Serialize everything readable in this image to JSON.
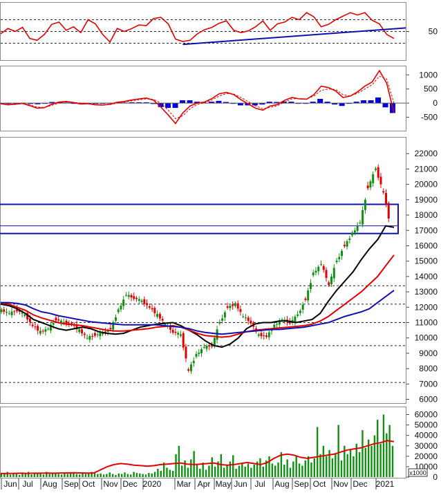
{
  "chart_data": [
    {
      "type": "line",
      "panel": "rsi",
      "ylim": [
        0,
        100
      ],
      "y_ticks": [
        "50"
      ],
      "reference_lines": [
        70,
        50,
        30
      ],
      "series": [
        {
          "values": [
            46,
            55,
            50,
            57,
            38,
            35,
            45,
            62,
            66,
            52,
            58,
            48,
            70,
            63,
            45,
            32,
            55,
            50,
            55,
            61,
            60,
            72,
            74,
            63,
            37,
            33,
            35,
            46,
            53,
            57,
            64,
            68,
            52,
            48,
            51,
            58,
            68,
            52,
            63,
            66,
            74,
            70,
            82,
            75,
            58,
            62,
            70,
            76,
            82,
            78,
            82,
            69,
            63,
            45,
            38
          ]
        }
      ],
      "trendline": {
        "points": [
          [
            25,
            28
          ],
          [
            54,
            55
          ]
        ]
      }
    },
    {
      "type": "line",
      "panel": "macd",
      "ylim": [
        -1000,
        1300
      ],
      "y_ticks": [
        "1000",
        "500",
        "0",
        "-500"
      ],
      "series": [
        {
          "values": [
            -20,
            -60,
            -40,
            -10,
            -90,
            -180,
            -160,
            -40,
            40,
            60,
            20,
            -30,
            -20,
            -60,
            -70,
            -40,
            30,
            60,
            110,
            150,
            180,
            100,
            -140,
            -420,
            -720,
            -350,
            -100,
            0,
            40,
            160,
            330,
            380,
            300,
            120,
            -30,
            -180,
            -250,
            -100,
            -50,
            100,
            200,
            150,
            140,
            300,
            600,
            550,
            430,
            200,
            250,
            400,
            600,
            750,
            1150,
            700,
            -350
          ]
        },
        {
          "values": [
            -10,
            -40,
            -40,
            -20,
            -60,
            -140,
            -150,
            -80,
            0,
            40,
            30,
            0,
            -10,
            -40,
            -60,
            -50,
            0,
            40,
            80,
            120,
            150,
            130,
            0,
            -250,
            -550,
            -450,
            -200,
            -50,
            20,
            110,
            250,
            340,
            320,
            200,
            50,
            -100,
            -200,
            -150,
            -90,
            40,
            150,
            160,
            150,
            250,
            450,
            500,
            480,
            300,
            250,
            350,
            500,
            650,
            950,
            850,
            0
          ]
        }
      ],
      "histogram": [
        -10,
        -20,
        0,
        10,
        -30,
        -40,
        -10,
        40,
        40,
        20,
        -10,
        -30,
        -10,
        -20,
        -10,
        10,
        30,
        20,
        30,
        30,
        30,
        -30,
        -140,
        -170,
        -170,
        100,
        100,
        50,
        20,
        50,
        80,
        40,
        -20,
        -80,
        -80,
        -80,
        -50,
        50,
        40,
        60,
        50,
        -10,
        -10,
        50,
        150,
        50,
        -50,
        -100,
        0,
        50,
        100,
        100,
        200,
        -150,
        -350
      ]
    },
    {
      "type": "line",
      "panel": "price",
      "ylim": [
        5800,
        23000
      ],
      "y_ticks": [
        "22000",
        "21000",
        "20000",
        "19000",
        "18000",
        "17000",
        "16000",
        "15000",
        "14000",
        "13000",
        "12000",
        "11000",
        "10000",
        "9000",
        "8000",
        "7000",
        "6000"
      ],
      "reference_lines": [
        13400,
        12200,
        11000,
        9500,
        7100
      ],
      "zone": [
        16800,
        18700
      ],
      "zone_midline": 17300,
      "series": [
        {
          "values": [
            11800,
            11600,
            11800,
            11500,
            10800,
            10400,
            10600,
            11200,
            11000,
            10900,
            10500,
            10000,
            10200,
            10300,
            10600,
            11800,
            12800,
            12600,
            12400,
            12000,
            11500,
            10900,
            10400,
            10200,
            7900,
            8900,
            9400,
            9500,
            11000,
            12000,
            12200,
            11400,
            11000,
            10200,
            10100,
            10800,
            11200,
            11000,
            11500,
            12500,
            14200,
            14800,
            13500,
            15000,
            16000,
            16800,
            17500,
            19800,
            21000,
            19500,
            17000
          ]
        },
        {
          "values": [
            12200,
            12100,
            11900,
            11600,
            11200,
            11000,
            10800,
            10600,
            10500,
            10600,
            10700,
            10600,
            10400,
            10300,
            10250,
            10300,
            10500,
            10700,
            10800,
            10900,
            10950,
            11000,
            10800,
            10500,
            10200,
            9800,
            9500,
            9400,
            9600,
            10000,
            10600,
            10900,
            11000,
            11000,
            11100,
            11100,
            11000,
            11100,
            11200,
            11600,
            12400,
            13100,
            13700,
            14300,
            15100,
            15800,
            16400,
            17300,
            17200
          ]
        },
        {
          "values": [
            12300,
            12200,
            12000,
            11800,
            11500,
            11300,
            11150,
            11000,
            10900,
            10850,
            10800,
            10700,
            10600,
            10500,
            10450,
            10450,
            10500,
            10550,
            10600,
            10700,
            10750,
            10800,
            10700,
            10500,
            10300,
            10150,
            10100,
            10050,
            10100,
            10250,
            10400,
            10500,
            10550,
            10600,
            10650,
            10700,
            10750,
            10800,
            10900,
            11100,
            11400,
            11800,
            12200,
            12600,
            13000,
            13500,
            14000,
            14700,
            15400
          ]
        },
        {
          "values": [
            12300,
            12300,
            12250,
            12150,
            11900,
            11700,
            11600,
            11450,
            11350,
            11250,
            11150,
            11050,
            11000,
            10950,
            10900,
            10850,
            10850,
            10850,
            10850,
            10850,
            10800,
            10750,
            10700,
            10600,
            10450,
            10350,
            10300,
            10250,
            10300,
            10350,
            10400,
            10450,
            10500,
            10550,
            10550,
            10600,
            10650,
            10700,
            10800,
            10900,
            11000,
            11200,
            11400,
            11550,
            11700,
            11900,
            12300,
            12700,
            13100
          ]
        }
      ]
    },
    {
      "type": "bar",
      "panel": "volume",
      "ylim": [
        0,
        65000
      ],
      "y_ticks": [
        "60000",
        "50000",
        "40000",
        "30000",
        "20000",
        "10000",
        "0"
      ],
      "y_unit": "x1000",
      "x_ticks": [
        "Jun",
        "Jul",
        "Aug",
        "Sep",
        "Oct",
        "Nov",
        "Dec",
        "2020",
        "Mar",
        "Apr",
        "May",
        "Jun",
        "Jul",
        "Aug",
        "Sep",
        "Oct",
        "Nov",
        "Dec",
        "2021"
      ],
      "values": [
        4000,
        3000,
        5000,
        2500,
        4000,
        3500,
        2000,
        4500,
        3000,
        5000,
        2500,
        3500,
        4000,
        3000,
        2500,
        5000,
        3000,
        4000,
        3500,
        3000,
        2500,
        4000,
        3000,
        3500,
        4500,
        3000,
        2500,
        4000,
        3000,
        3500,
        5000,
        4000,
        3000,
        3500,
        2500,
        3000,
        4500,
        3000,
        2000,
        3500,
        3000,
        4500,
        3000,
        2500,
        5000,
        4000,
        3500,
        3000,
        2500,
        4000,
        3500,
        5000,
        8000,
        6000,
        14000,
        9000,
        7000,
        6000,
        22000,
        30000,
        11000,
        16000,
        9000,
        17000,
        25000,
        12000,
        8000,
        14000,
        7000,
        11000,
        19000,
        10000,
        15000,
        22000,
        9000,
        12000,
        15000,
        21000,
        8000,
        11000,
        14000,
        10000,
        13000,
        9000,
        12000,
        15000,
        18000,
        10000,
        16000,
        20000,
        13000,
        11000,
        14000,
        24000,
        12000,
        17000,
        9000,
        15000,
        20000,
        13000,
        11000,
        16000,
        20000,
        14000,
        18000,
        48000,
        22000,
        30000,
        20000,
        26000,
        18000,
        22000,
        50000,
        16000,
        30000,
        22000,
        26000,
        20000,
        32000,
        24000,
        45000,
        28000,
        36000,
        30000,
        40000,
        55000,
        32000,
        60000,
        42000,
        50000,
        30000
      ],
      "ma_values": [
        3500,
        3500,
        3600,
        3700,
        3600,
        3700,
        3700,
        3800,
        3700,
        3900,
        4000,
        4200,
        4000,
        3800,
        4000,
        7000,
        10000,
        12000,
        13000,
        12500,
        11500,
        11000,
        10500,
        11000,
        12000,
        12500,
        13000,
        13500,
        12500,
        12000,
        12500,
        13000,
        13500,
        12000,
        11500,
        12000,
        13000,
        14000,
        13000,
        12000,
        14000,
        18000,
        21000,
        22000,
        21000,
        19000,
        18000,
        19000,
        20000,
        21000,
        22000,
        24000,
        26000,
        27000,
        28000,
        30000,
        32000,
        33000,
        35000,
        34000
      ]
    }
  ]
}
